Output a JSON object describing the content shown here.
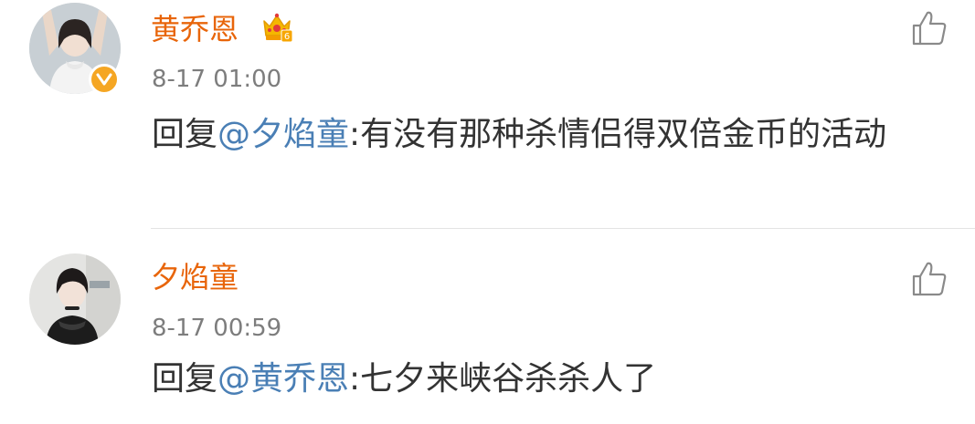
{
  "comments": [
    {
      "username": "黄乔恩",
      "timestamp": "8-17 01:00",
      "reply_prefix": "回复",
      "mention": "@夕焰童",
      "separator": ":",
      "text": "有没有那种杀情侣得双倍金币的活动",
      "avatar_icon": "avatar-photo",
      "verified": true,
      "vip_badge": true,
      "like_icon": "thumbs-up-icon"
    },
    {
      "username": "夕焰童",
      "timestamp": "8-17 00:59",
      "reply_prefix": "回复",
      "mention": "@黄乔恩",
      "separator": ":",
      "text": "七夕来峡谷杀杀人了",
      "avatar_icon": "avatar-photo",
      "verified": false,
      "vip_badge": false,
      "like_icon": "thumbs-up-icon"
    }
  ],
  "colors": {
    "username": "#e8650a",
    "mention": "#4a7fb5",
    "timestamp": "#7d7d7d",
    "content": "#333333",
    "verified_badge": "#f5a623",
    "divider": "#e3e3e3"
  }
}
